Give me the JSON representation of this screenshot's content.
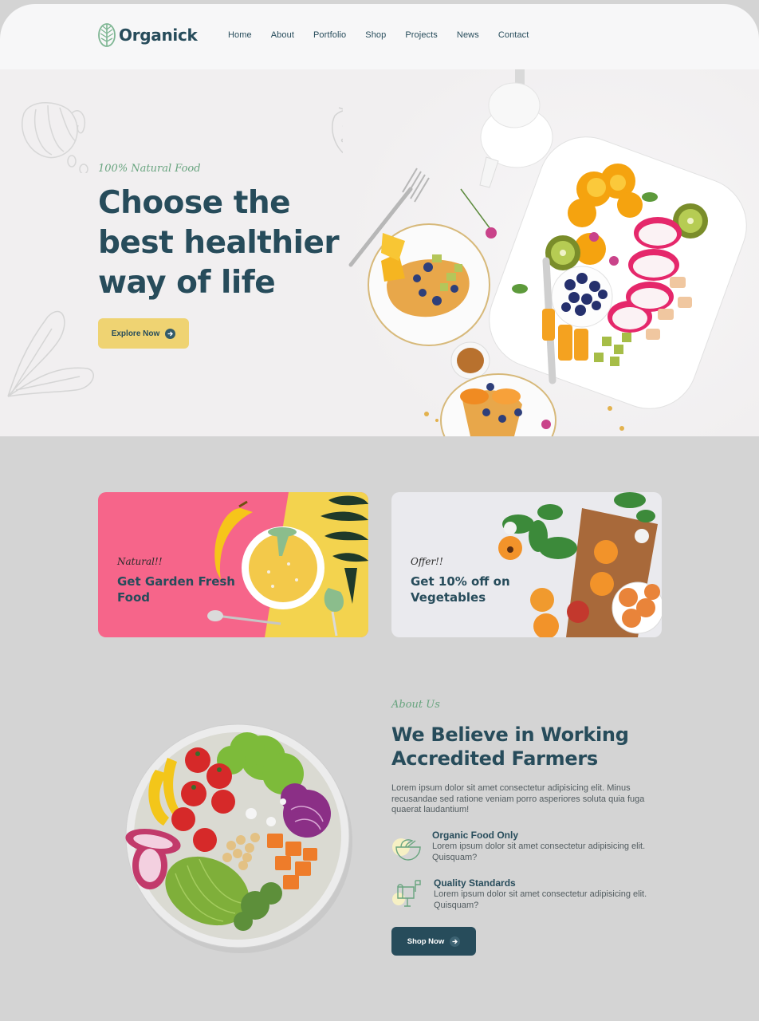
{
  "brand": {
    "name": "Organick"
  },
  "nav": {
    "items": [
      "Home",
      "About",
      "Portfolio",
      "Shop",
      "Projects",
      "News",
      "Contact"
    ]
  },
  "hero": {
    "script": "100% Natural Food",
    "title": "Choose the best healthier way of life",
    "cta": "Explore Now"
  },
  "offers": [
    {
      "script": "Natural!!",
      "title": "Get Garden Fresh Food",
      "background": "#f6658a"
    },
    {
      "script": "Offer!!",
      "title": "Get 10% off on Vegetables",
      "background": "#eaeaee"
    }
  ],
  "about": {
    "script": "About Us",
    "title": "We Believe in Working Accredited Farmers",
    "text": "Lorem ipsum dolor sit amet consectetur adipisicing elit. Minus recusandae sed ratione veniam porro asperiores soluta quia fuga quaerat laudantium!",
    "features": [
      {
        "title": "Organic Food Only",
        "text": "Lorem ipsum dolor sit amet consectetur adipisicing elit. Quisquam?",
        "icon": "bowl-icon"
      },
      {
        "title": "Quality Standards",
        "text": "Lorem ipsum dolor sit amet consectetur adipisicing elit. Quisquam?",
        "icon": "mailbox-icon"
      }
    ],
    "cta": "Shop Now"
  },
  "colors": {
    "primary": "#274c5b",
    "accent_green": "#68a47f",
    "accent_yellow": "#efd372",
    "pink": "#f6658a"
  }
}
